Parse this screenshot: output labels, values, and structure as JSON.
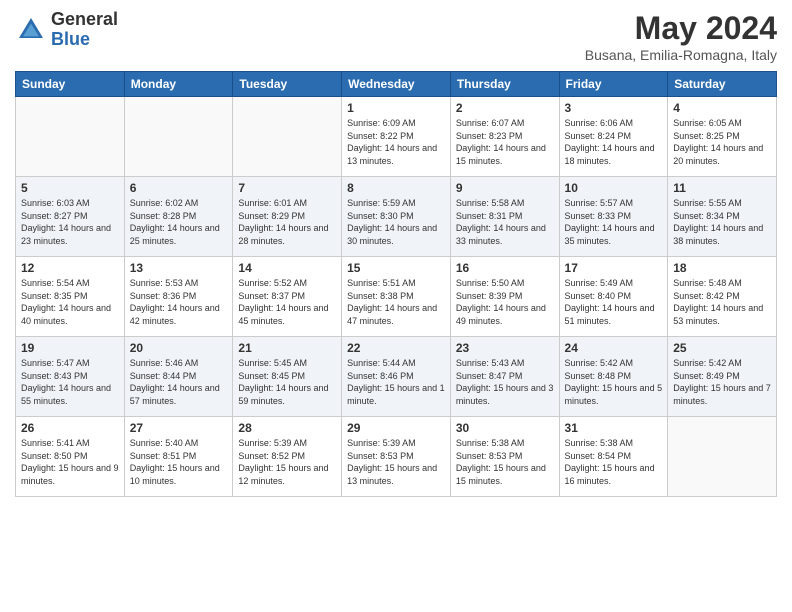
{
  "header": {
    "logo_general": "General",
    "logo_blue": "Blue",
    "month": "May 2024",
    "location": "Busana, Emilia-Romagna, Italy"
  },
  "days_of_week": [
    "Sunday",
    "Monday",
    "Tuesday",
    "Wednesday",
    "Thursday",
    "Friday",
    "Saturday"
  ],
  "weeks": [
    [
      {
        "day": "",
        "info": ""
      },
      {
        "day": "",
        "info": ""
      },
      {
        "day": "",
        "info": ""
      },
      {
        "day": "1",
        "info": "Sunrise: 6:09 AM\nSunset: 8:22 PM\nDaylight: 14 hours\nand 13 minutes."
      },
      {
        "day": "2",
        "info": "Sunrise: 6:07 AM\nSunset: 8:23 PM\nDaylight: 14 hours\nand 15 minutes."
      },
      {
        "day": "3",
        "info": "Sunrise: 6:06 AM\nSunset: 8:24 PM\nDaylight: 14 hours\nand 18 minutes."
      },
      {
        "day": "4",
        "info": "Sunrise: 6:05 AM\nSunset: 8:25 PM\nDaylight: 14 hours\nand 20 minutes."
      }
    ],
    [
      {
        "day": "5",
        "info": "Sunrise: 6:03 AM\nSunset: 8:27 PM\nDaylight: 14 hours\nand 23 minutes."
      },
      {
        "day": "6",
        "info": "Sunrise: 6:02 AM\nSunset: 8:28 PM\nDaylight: 14 hours\nand 25 minutes."
      },
      {
        "day": "7",
        "info": "Sunrise: 6:01 AM\nSunset: 8:29 PM\nDaylight: 14 hours\nand 28 minutes."
      },
      {
        "day": "8",
        "info": "Sunrise: 5:59 AM\nSunset: 8:30 PM\nDaylight: 14 hours\nand 30 minutes."
      },
      {
        "day": "9",
        "info": "Sunrise: 5:58 AM\nSunset: 8:31 PM\nDaylight: 14 hours\nand 33 minutes."
      },
      {
        "day": "10",
        "info": "Sunrise: 5:57 AM\nSunset: 8:33 PM\nDaylight: 14 hours\nand 35 minutes."
      },
      {
        "day": "11",
        "info": "Sunrise: 5:55 AM\nSunset: 8:34 PM\nDaylight: 14 hours\nand 38 minutes."
      }
    ],
    [
      {
        "day": "12",
        "info": "Sunrise: 5:54 AM\nSunset: 8:35 PM\nDaylight: 14 hours\nand 40 minutes."
      },
      {
        "day": "13",
        "info": "Sunrise: 5:53 AM\nSunset: 8:36 PM\nDaylight: 14 hours\nand 42 minutes."
      },
      {
        "day": "14",
        "info": "Sunrise: 5:52 AM\nSunset: 8:37 PM\nDaylight: 14 hours\nand 45 minutes."
      },
      {
        "day": "15",
        "info": "Sunrise: 5:51 AM\nSunset: 8:38 PM\nDaylight: 14 hours\nand 47 minutes."
      },
      {
        "day": "16",
        "info": "Sunrise: 5:50 AM\nSunset: 8:39 PM\nDaylight: 14 hours\nand 49 minutes."
      },
      {
        "day": "17",
        "info": "Sunrise: 5:49 AM\nSunset: 8:40 PM\nDaylight: 14 hours\nand 51 minutes."
      },
      {
        "day": "18",
        "info": "Sunrise: 5:48 AM\nSunset: 8:42 PM\nDaylight: 14 hours\nand 53 minutes."
      }
    ],
    [
      {
        "day": "19",
        "info": "Sunrise: 5:47 AM\nSunset: 8:43 PM\nDaylight: 14 hours\nand 55 minutes."
      },
      {
        "day": "20",
        "info": "Sunrise: 5:46 AM\nSunset: 8:44 PM\nDaylight: 14 hours\nand 57 minutes."
      },
      {
        "day": "21",
        "info": "Sunrise: 5:45 AM\nSunset: 8:45 PM\nDaylight: 14 hours\nand 59 minutes."
      },
      {
        "day": "22",
        "info": "Sunrise: 5:44 AM\nSunset: 8:46 PM\nDaylight: 15 hours\nand 1 minute."
      },
      {
        "day": "23",
        "info": "Sunrise: 5:43 AM\nSunset: 8:47 PM\nDaylight: 15 hours\nand 3 minutes."
      },
      {
        "day": "24",
        "info": "Sunrise: 5:42 AM\nSunset: 8:48 PM\nDaylight: 15 hours\nand 5 minutes."
      },
      {
        "day": "25",
        "info": "Sunrise: 5:42 AM\nSunset: 8:49 PM\nDaylight: 15 hours\nand 7 minutes."
      }
    ],
    [
      {
        "day": "26",
        "info": "Sunrise: 5:41 AM\nSunset: 8:50 PM\nDaylight: 15 hours\nand 9 minutes."
      },
      {
        "day": "27",
        "info": "Sunrise: 5:40 AM\nSunset: 8:51 PM\nDaylight: 15 hours\nand 10 minutes."
      },
      {
        "day": "28",
        "info": "Sunrise: 5:39 AM\nSunset: 8:52 PM\nDaylight: 15 hours\nand 12 minutes."
      },
      {
        "day": "29",
        "info": "Sunrise: 5:39 AM\nSunset: 8:53 PM\nDaylight: 15 hours\nand 13 minutes."
      },
      {
        "day": "30",
        "info": "Sunrise: 5:38 AM\nSunset: 8:53 PM\nDaylight: 15 hours\nand 15 minutes."
      },
      {
        "day": "31",
        "info": "Sunrise: 5:38 AM\nSunset: 8:54 PM\nDaylight: 15 hours\nand 16 minutes."
      },
      {
        "day": "",
        "info": ""
      }
    ]
  ]
}
